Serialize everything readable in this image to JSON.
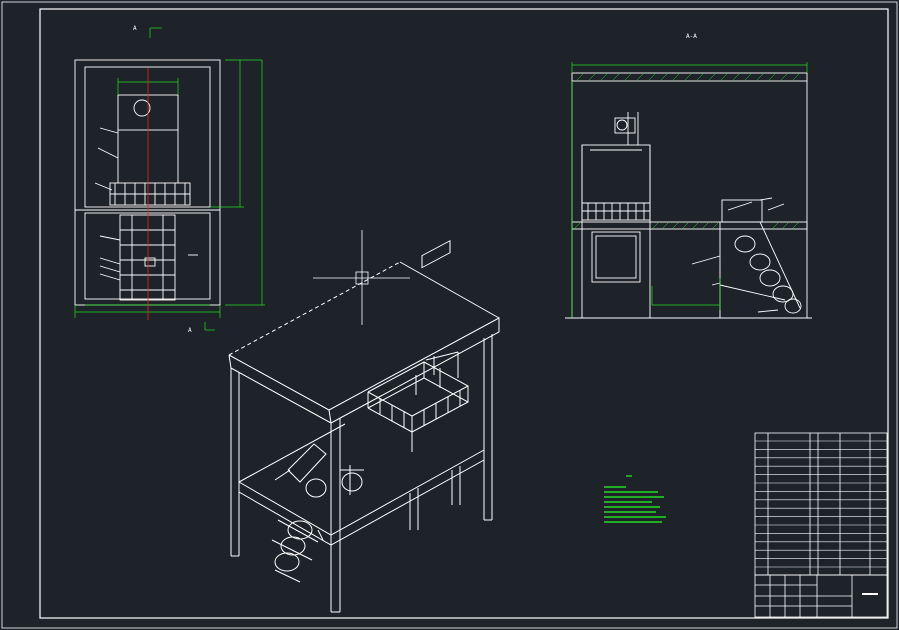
{
  "drawing": {
    "background": "#1e2329",
    "line_color": "#ffffff",
    "dimension_color": "#22dd22",
    "annotation_color": "#ee2222",
    "top_view_marker": "A",
    "side_view_title": "A-A",
    "section_marker_bottom": "A"
  }
}
